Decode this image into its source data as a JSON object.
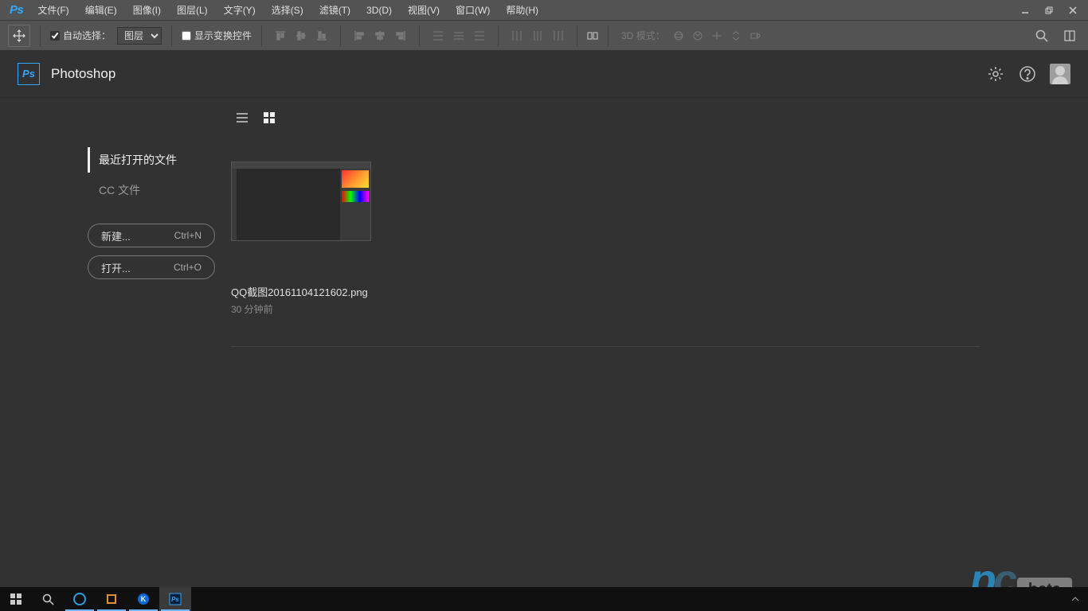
{
  "app": {
    "logo_text": "Ps",
    "name": "Photoshop"
  },
  "menubar": {
    "items": [
      "文件(F)",
      "编辑(E)",
      "图像(I)",
      "图层(L)",
      "文字(Y)",
      "选择(S)",
      "滤镜(T)",
      "3D(D)",
      "视图(V)",
      "窗口(W)",
      "帮助(H)"
    ]
  },
  "optionsbar": {
    "auto_select_label": "自动选择：",
    "auto_select_checked": true,
    "dropdown_value": "图层",
    "show_transform_label": "显示变换控件",
    "show_transform_checked": false,
    "mode3d_label": "3D 模式："
  },
  "start": {
    "nav": {
      "recent": "最近打开的文件",
      "cc_files": "CC 文件"
    },
    "actions": {
      "new_label": "新建...",
      "new_shortcut": "Ctrl+N",
      "open_label": "打开...",
      "open_shortcut": "Ctrl+O"
    },
    "recent_file": {
      "name": "QQ截图20161104121602.png",
      "time": "30 分钟前"
    }
  },
  "watermark": {
    "text": "pc",
    "badge": "beta"
  }
}
